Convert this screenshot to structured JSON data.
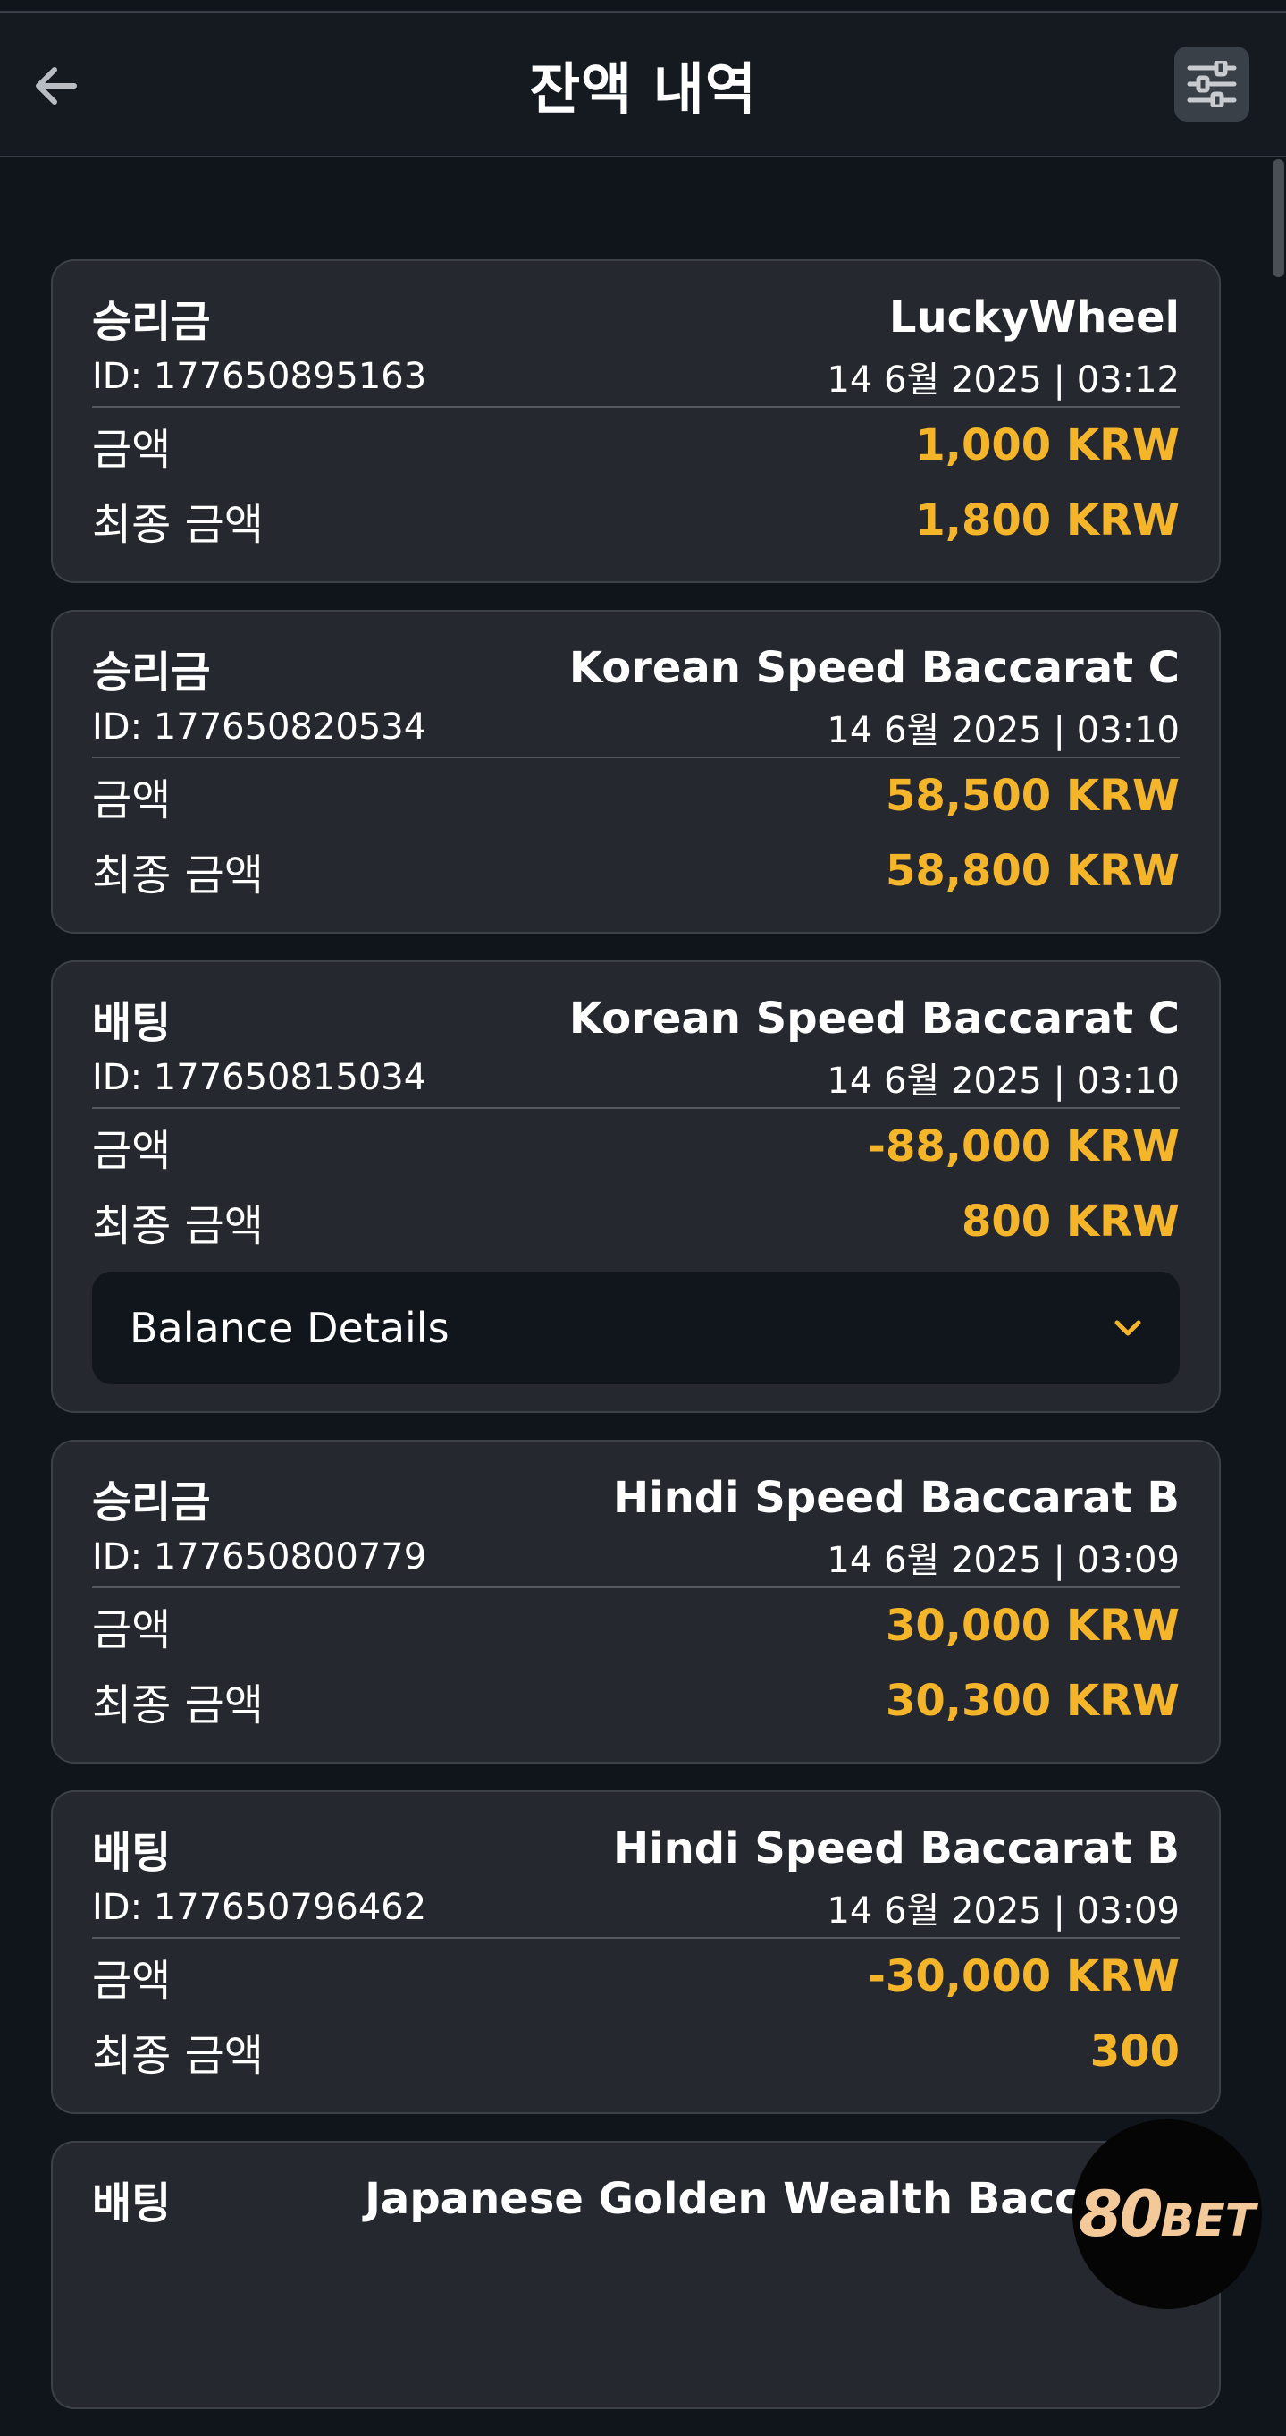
{
  "header": {
    "title": "잔액 내역",
    "back_icon": "arrow-left-icon",
    "filter_icon": "sliders-icon"
  },
  "labels": {
    "amount": "금액",
    "final_amount": "최종 금액",
    "balance_details": "Balance Details"
  },
  "transactions": [
    {
      "type": "승리금",
      "game": "LuckyWheel",
      "id": "ID: 177650895163",
      "datetime": "14 6월 2025 | 03:12",
      "amount": "1,000 KRW",
      "final_amount": "1,800 KRW"
    },
    {
      "type": "승리금",
      "game": "Korean Speed Baccarat C",
      "id": "ID: 177650820534",
      "datetime": "14 6월 2025 | 03:10",
      "amount": "58,500 KRW",
      "final_amount": "58,800 KRW"
    },
    {
      "type": "배팅",
      "game": "Korean Speed Baccarat C",
      "id": "ID: 177650815034",
      "datetime": "14 6월 2025 | 03:10",
      "amount": "-88,000 KRW",
      "final_amount": "800 KRW"
    },
    {
      "type": "승리금",
      "game": "Hindi Speed Baccarat B",
      "id": "ID: 177650800779",
      "datetime": "14 6월 2025 | 03:09",
      "amount": "30,000 KRW",
      "final_amount": "30,300 KRW"
    },
    {
      "type": "배팅",
      "game": "Hindi Speed Baccarat B",
      "id": "ID: 177650796462",
      "datetime": "14 6월 2025 | 03:09",
      "amount": "-30,000 KRW",
      "final_amount": "300"
    },
    {
      "type": "배팅",
      "game": "Japanese Golden Wealth Baccarat"
    }
  ],
  "logo": {
    "main": "80",
    "suffix": "BET"
  },
  "colors": {
    "background": "#10151c",
    "card": "#25282e",
    "accent": "#f5b52a",
    "logo": "#f3c99a"
  }
}
